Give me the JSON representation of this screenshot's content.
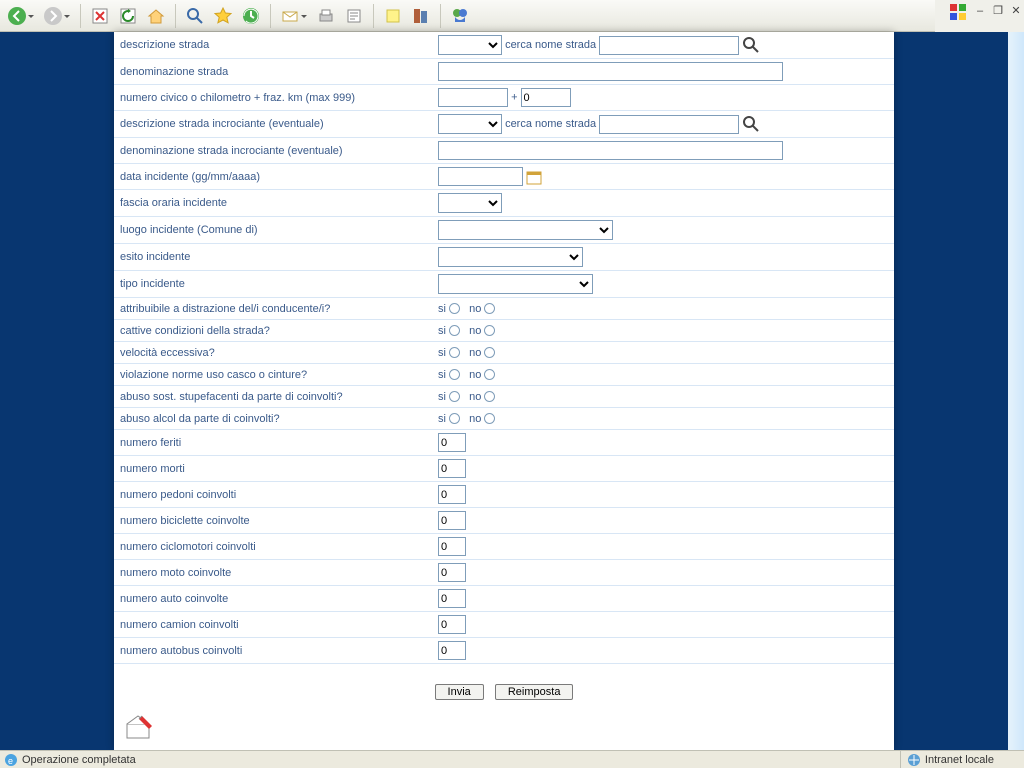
{
  "status": {
    "left": "Operazione completata",
    "right": "Intranet locale"
  },
  "labels": {
    "descrizione_strada": "descrizione strada",
    "cerca_nome_strada": "cerca nome strada",
    "denom_strada": "denominazione strada",
    "numero_civico": "numero civico o chilometro + fraz. km (max 999)",
    "descr_incrociante": "descrizione strada incrociante (eventuale)",
    "denom_incrociante": "denominazione strada incrociante (eventuale)",
    "data_incidente": "data incidente (gg/mm/aaaa)",
    "fascia_oraria": "fascia oraria incidente",
    "luogo_incidente": "luogo incidente (Comune di)",
    "esito": "esito incidente",
    "tipo": "tipo incidente",
    "q_distrazione": "attribuibile a distrazione del/i conducente/i?",
    "q_condizioni": "cattive condizioni della strada?",
    "q_velocita": "velocità eccessiva?",
    "q_violazione": "violazione norme uso casco o cinture?",
    "q_stupefacenti": "abuso sost. stupefacenti da parte di coinvolti?",
    "q_alcol": "abuso alcol da parte di coinvolti?",
    "n_feriti": "numero feriti",
    "n_morti": "numero morti",
    "n_pedoni": "numero pedoni coinvolti",
    "n_bici": "numero biciclette coinvolte",
    "n_ciclo": "numero ciclomotori coinvolti",
    "n_moto": "numero moto coinvolte",
    "n_auto": "numero auto coinvolte",
    "n_camion": "numero camion coinvolti",
    "n_autobus": "numero autobus coinvolti",
    "si": "si",
    "no": "no",
    "plus": " + "
  },
  "values": {
    "fraz_km": "0",
    "n_feriti": "0",
    "n_morti": "0",
    "n_pedoni": "0",
    "n_bici": "0",
    "n_ciclo": "0",
    "n_moto": "0",
    "n_auto": "0",
    "n_camion": "0",
    "n_autobus": "0"
  },
  "buttons": {
    "invia": "Invia",
    "reimposta": "Reimposta"
  }
}
